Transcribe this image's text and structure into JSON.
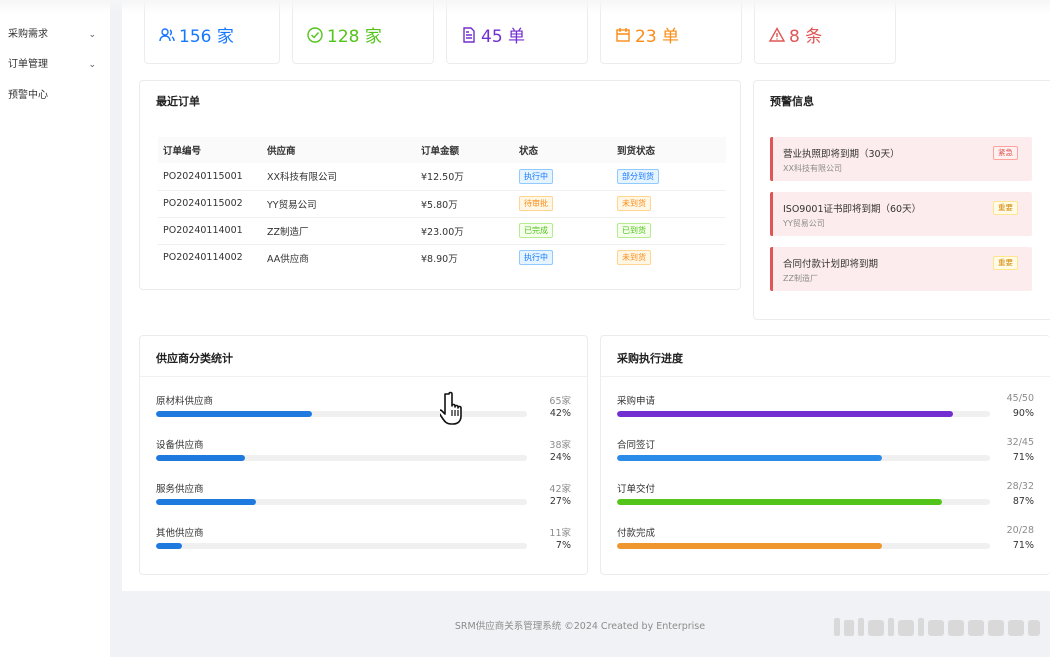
{
  "sidebar": {
    "items": [
      {
        "label": "采购需求",
        "expandable": true
      },
      {
        "label": "订单管理",
        "expandable": true
      },
      {
        "label": "预警中心",
        "expandable": false
      }
    ]
  },
  "stats": [
    {
      "value": "156 家",
      "icon": "supplier-icon",
      "color": "#1677ff"
    },
    {
      "value": "128 家",
      "icon": "check-circle-icon",
      "color": "#52c41a"
    },
    {
      "value": "45 单",
      "icon": "document-icon",
      "color": "#722ed1"
    },
    {
      "value": "23 单",
      "icon": "calendar-icon",
      "color": "#fa8c16"
    },
    {
      "value": "8 条",
      "icon": "warning-icon",
      "color": "#e05656"
    }
  ],
  "recent_orders": {
    "title": "最近订单",
    "columns": [
      "订单编号",
      "供应商",
      "订单金额",
      "状态",
      "到货状态"
    ],
    "rows": [
      {
        "id": "PO20240115001",
        "supplier": "XX科技有限公司",
        "amount": "¥12.50万",
        "status": "执行中",
        "status_color": "blue",
        "arrival": "部分到货",
        "arrival_color": "blue"
      },
      {
        "id": "PO20240115002",
        "supplier": "YY贸易公司",
        "amount": "¥5.80万",
        "status": "待审批",
        "status_color": "orange",
        "arrival": "未到货",
        "arrival_color": "orange"
      },
      {
        "id": "PO20240114001",
        "supplier": "ZZ制造厂",
        "amount": "¥23.00万",
        "status": "已完成",
        "status_color": "green",
        "arrival": "已到货",
        "arrival_color": "green"
      },
      {
        "id": "PO20240114002",
        "supplier": "AA供应商",
        "amount": "¥8.90万",
        "status": "执行中",
        "status_color": "blue",
        "arrival": "未到货",
        "arrival_color": "orange"
      }
    ]
  },
  "alerts": {
    "title": "预警信息",
    "items": [
      {
        "title": "营业执照即将到期（30天）",
        "sub": "XX科技有限公司",
        "badge": "紧急",
        "level": "urgent"
      },
      {
        "title": "ISO9001证书即将到期（60天）",
        "sub": "YY贸易公司",
        "badge": "重要",
        "level": "important"
      },
      {
        "title": "合同付款计划即将到期",
        "sub": "ZZ制造厂",
        "badge": "重要",
        "level": "important"
      }
    ]
  },
  "supplier_stats": {
    "title": "供应商分类统计",
    "items": [
      {
        "label": "原材料供应商",
        "count": "65家",
        "pct": "42%",
        "fraction": 0.42,
        "color": "#1f7ae0"
      },
      {
        "label": "设备供应商",
        "count": "38家",
        "pct": "24%",
        "fraction": 0.24,
        "color": "#1f7ae0"
      },
      {
        "label": "服务供应商",
        "count": "42家",
        "pct": "27%",
        "fraction": 0.27,
        "color": "#1f7ae0"
      },
      {
        "label": "其他供应商",
        "count": "11家",
        "pct": "7%",
        "fraction": 0.07,
        "color": "#1f7ae0"
      }
    ]
  },
  "procurement_progress": {
    "title": "采购执行进度",
    "items": [
      {
        "label": "采购申请",
        "count": "45/50",
        "pct": "90%",
        "fraction": 0.9,
        "color": "#722ed1"
      },
      {
        "label": "合同签订",
        "count": "32/45",
        "pct": "71%",
        "fraction": 0.71,
        "color": "#2b8be8"
      },
      {
        "label": "订单交付",
        "count": "28/32",
        "pct": "87%",
        "fraction": 0.87,
        "color": "#52c41a"
      },
      {
        "label": "付款完成",
        "count": "20/28",
        "pct": "71%",
        "fraction": 0.71,
        "color": "#f0962e"
      }
    ]
  },
  "footer": {
    "text": "SRM供应商关系管理系统 ©2024 Created by Enterprise"
  }
}
